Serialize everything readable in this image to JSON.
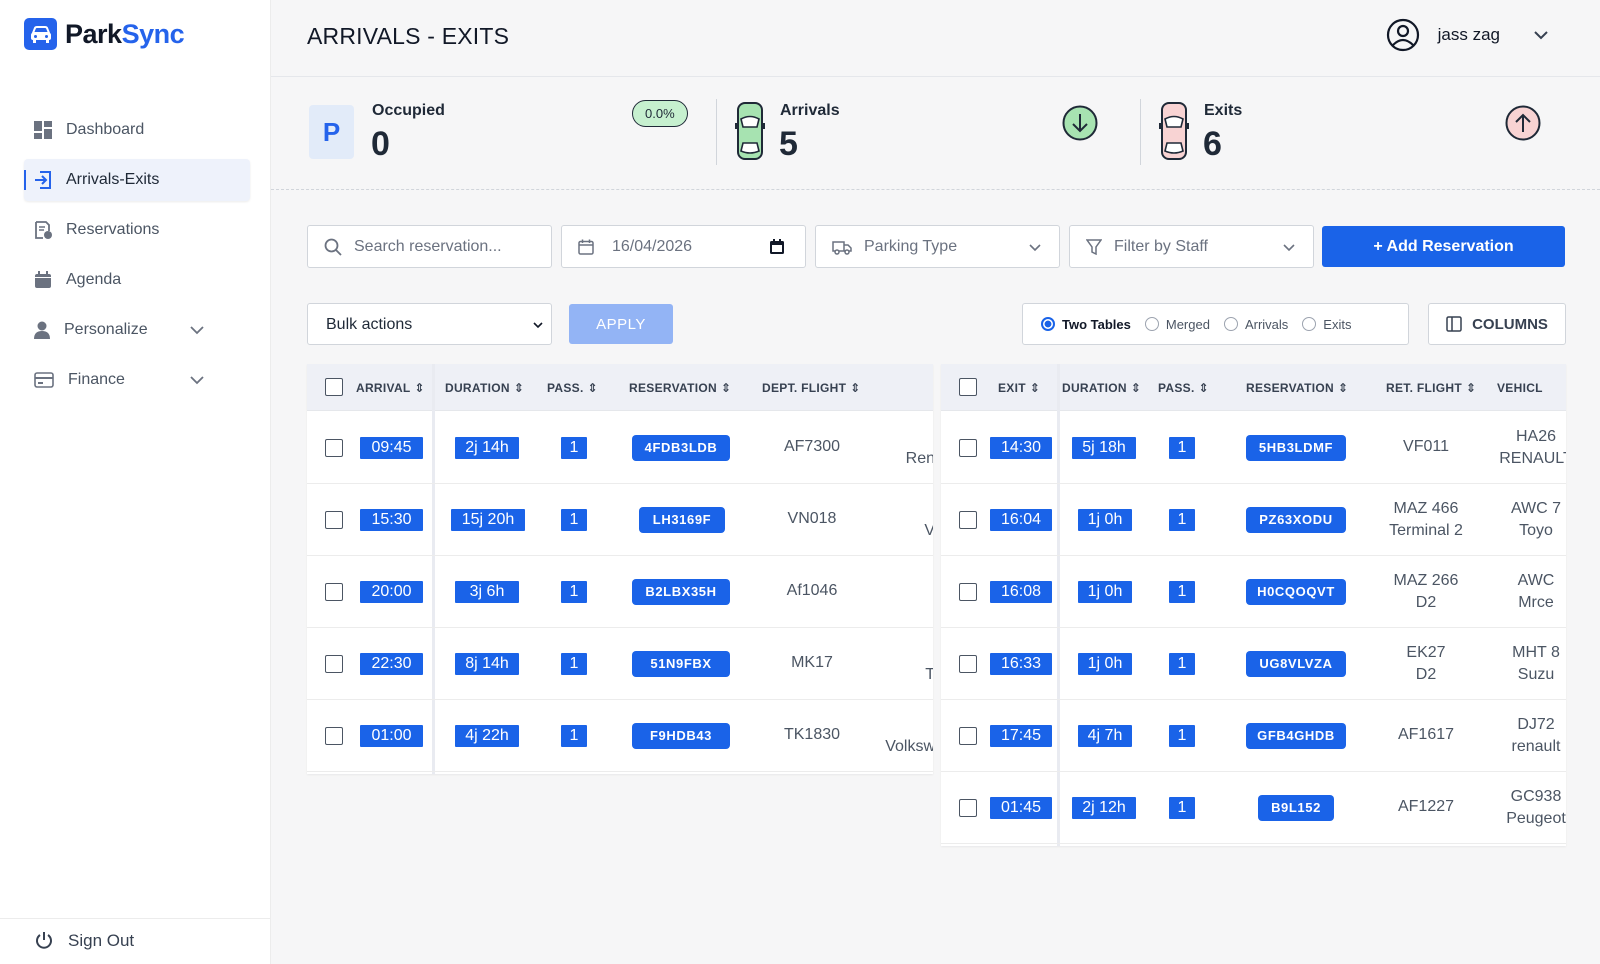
{
  "app": {
    "brand_part1": "Park",
    "brand_part2": "Sync"
  },
  "sidebar": {
    "items": [
      {
        "label": "Dashboard"
      },
      {
        "label": "Arrivals-Exits"
      },
      {
        "label": "Reservations"
      },
      {
        "label": "Agenda"
      },
      {
        "label": "Personalize"
      },
      {
        "label": "Finance"
      }
    ],
    "sign_out": "Sign Out"
  },
  "header": {
    "title": "ARRIVALS - EXITS",
    "user_name": "jass zag"
  },
  "stats": {
    "occupied": {
      "icon_letter": "P",
      "label": "Occupied",
      "value": "0",
      "percent": "0.0%"
    },
    "arrivals": {
      "label": "Arrivals",
      "value": "5"
    },
    "exits": {
      "label": "Exits",
      "value": "6"
    }
  },
  "toolbar": {
    "search_placeholder": "Search reservation...",
    "date": "16/04/2026",
    "parking_type": "Parking Type",
    "filter_staff": "Filter by Staff",
    "add_button": "+ Add Reservation",
    "bulk_actions": "Bulk actions",
    "apply": "APPLY",
    "view_modes": [
      "Two Tables",
      "Merged",
      "Arrivals",
      "Exits"
    ],
    "selected_view": "Two Tables",
    "columns": "COLUMNS"
  },
  "arrivals_table": {
    "headers": [
      "ARRIVAL",
      "DURATION",
      "PASS.",
      "RESERVATION",
      "DEPT. FLIGHT"
    ],
    "rows": [
      {
        "time": "09:45",
        "duration": "2j 14h",
        "pass": "1",
        "reservation": "4FDB3LDB",
        "flight": "AF7300",
        "vehicle": "Ren"
      },
      {
        "time": "15:30",
        "duration": "15j 20h",
        "pass": "1",
        "reservation": "LH3169F",
        "flight": "VN018",
        "vehicle": "V"
      },
      {
        "time": "20:00",
        "duration": "3j 6h",
        "pass": "1",
        "reservation": "B2LBX35H",
        "flight": "Af1046",
        "vehicle": ""
      },
      {
        "time": "22:30",
        "duration": "8j 14h",
        "pass": "1",
        "reservation": "51N9FBX",
        "flight": "MK17",
        "vehicle": "T"
      },
      {
        "time": "01:00",
        "duration": "4j 22h",
        "pass": "1",
        "reservation": "F9HDB43",
        "flight": "TK1830",
        "vehicle": "Volksw"
      }
    ]
  },
  "exits_table": {
    "headers": [
      "EXIT",
      "DURATION",
      "PASS.",
      "RESERVATION",
      "RET. FLIGHT",
      "VEHICL"
    ],
    "rows": [
      {
        "time": "14:30",
        "duration": "5j 18h",
        "pass": "1",
        "reservation": "5HB3LDMF",
        "flight": "VF011",
        "flight_sub": "",
        "vehicle": "HA26",
        "vehicle_sub": "RENAULT"
      },
      {
        "time": "16:04",
        "duration": "1j 0h",
        "pass": "1",
        "reservation": "PZ63XODU",
        "flight": "MAZ 466",
        "flight_sub": "Terminal 2",
        "vehicle": "AWC 7",
        "vehicle_sub": "Toyo"
      },
      {
        "time": "16:08",
        "duration": "1j 0h",
        "pass": "1",
        "reservation": "H0CQOQVT",
        "flight": "MAZ 266",
        "flight_sub": "D2",
        "vehicle": "AWC",
        "vehicle_sub": "Mrce"
      },
      {
        "time": "16:33",
        "duration": "1j 0h",
        "pass": "1",
        "reservation": "UG8VLVZA",
        "flight": "EK27",
        "flight_sub": "D2",
        "vehicle": "MHT 8",
        "vehicle_sub": "Suzu"
      },
      {
        "time": "17:45",
        "duration": "4j 7h",
        "pass": "1",
        "reservation": "GFB4GHDB",
        "flight": "AF1617",
        "flight_sub": "",
        "vehicle": "DJ72",
        "vehicle_sub": "renault"
      },
      {
        "time": "01:45",
        "duration": "2j 12h",
        "pass": "1",
        "reservation": "B9L152",
        "flight": "AF1227",
        "flight_sub": "",
        "vehicle": "GC938",
        "vehicle_sub": "Peugeot"
      }
    ]
  },
  "colors": {
    "accent": "#1a63e8",
    "badge_green": "#c6f0cf",
    "arrival_green": "#a7e3b1",
    "exit_pink": "#f8d3d3"
  }
}
